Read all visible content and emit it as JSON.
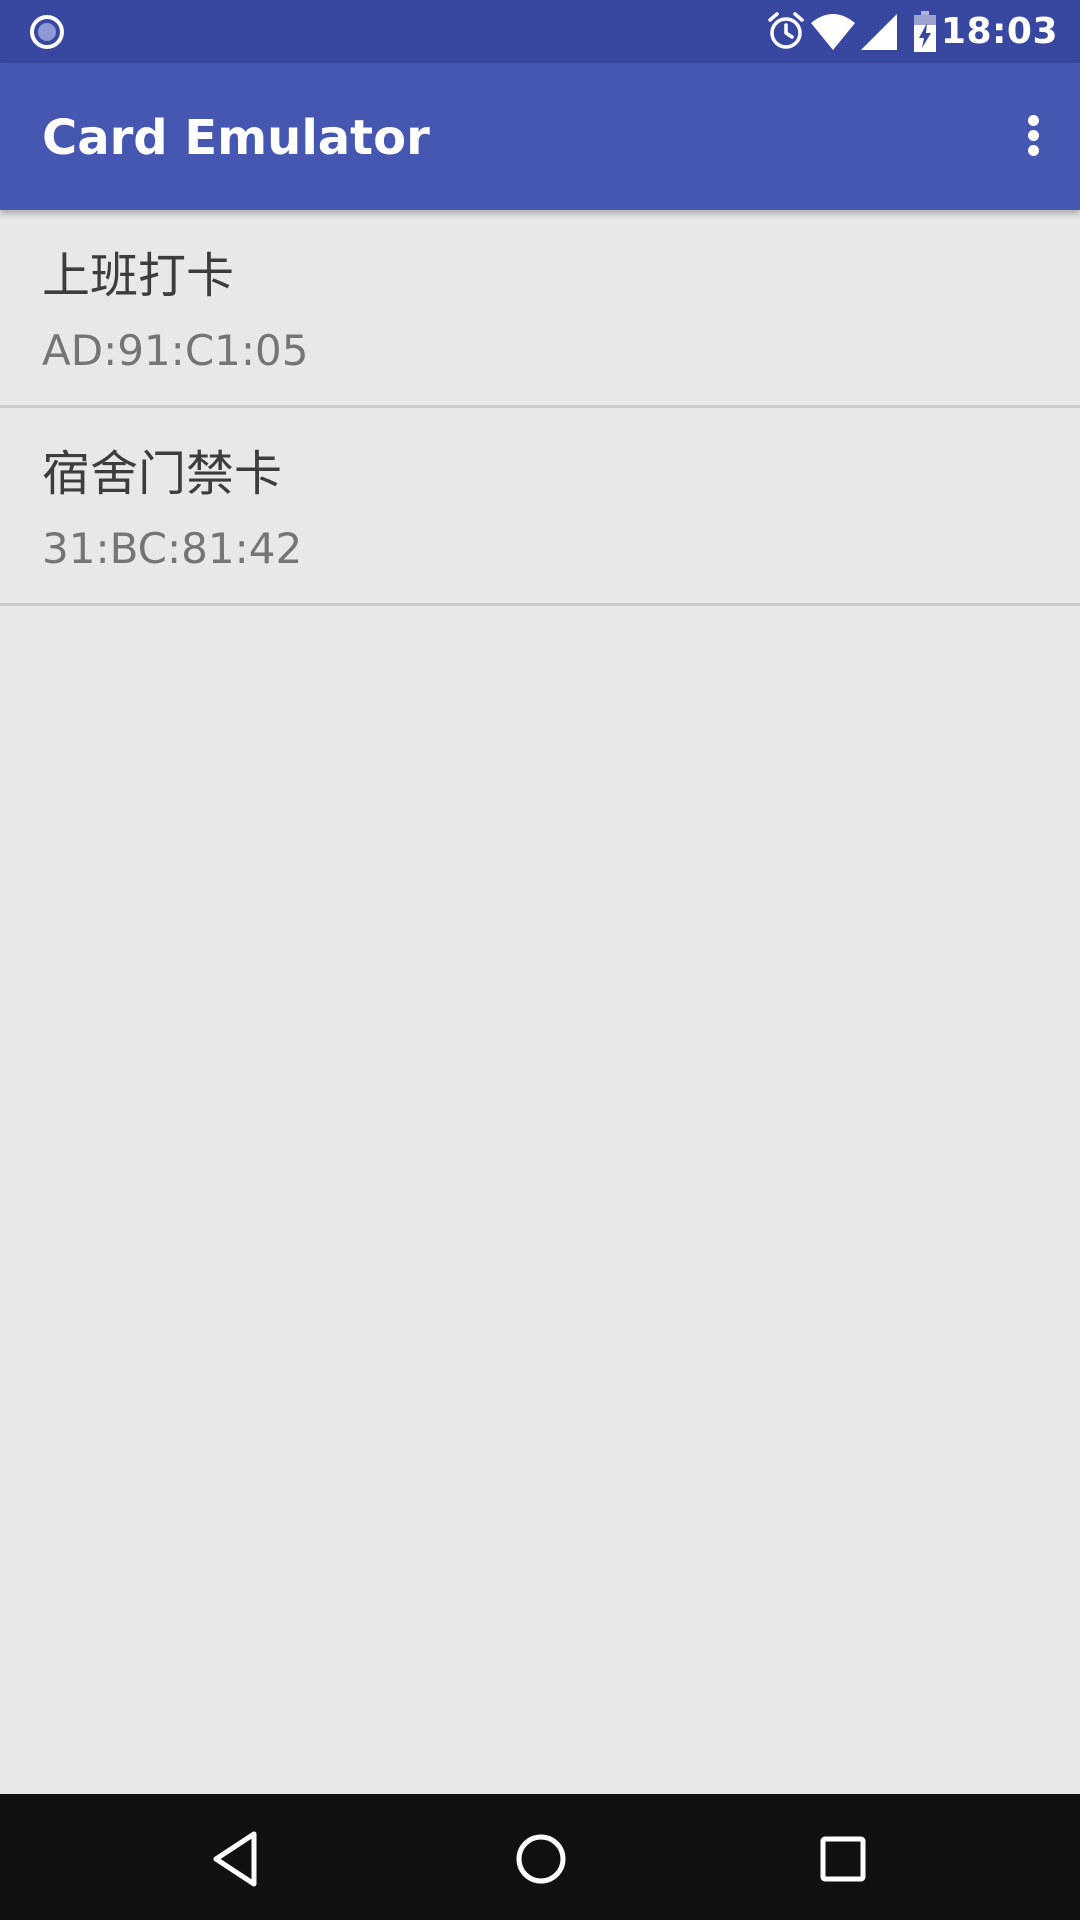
{
  "status_bar": {
    "time": "18:03",
    "icons": [
      "notification-circle-icon",
      "alarm-icon",
      "wifi-icon",
      "signal-icon",
      "battery-charging-icon"
    ]
  },
  "app_bar": {
    "title": "Card Emulator",
    "menu_icon": "more-vert-icon"
  },
  "cards": [
    {
      "name": "上班打卡",
      "id": "AD:91:C1:05"
    },
    {
      "name": "宿舍门禁卡",
      "id": "31:BC:81:42"
    }
  ],
  "nav_bar": {
    "icons": [
      "back-icon",
      "home-icon",
      "recents-icon"
    ]
  },
  "colors": {
    "status_bar": "#3847a0",
    "app_bar": "#4557b1",
    "background": "#e8e8e8",
    "divider": "#cbcbcb",
    "nav_bar": "#111111"
  }
}
